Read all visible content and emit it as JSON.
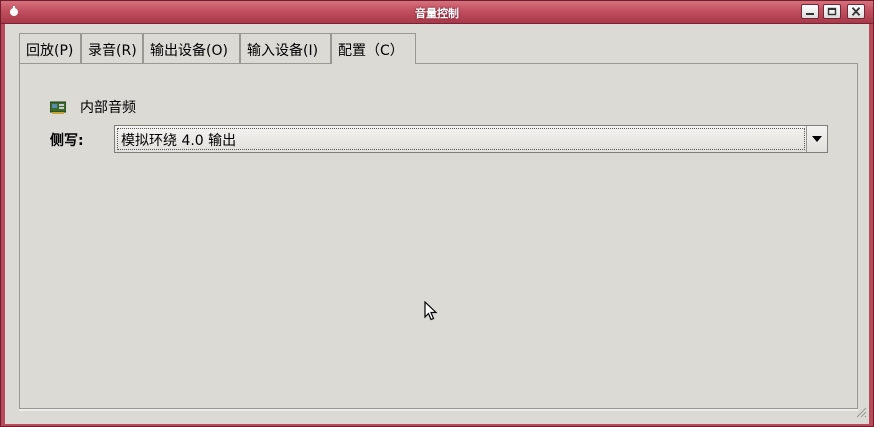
{
  "window": {
    "title": "音量控制",
    "app_icon": "mixer-icon",
    "buttons": [
      "minimize-icon",
      "maximize-icon",
      "close-icon"
    ]
  },
  "tabs": [
    {
      "label": "回放(P)"
    },
    {
      "label": "录音(R)"
    },
    {
      "label": "输出设备(O)"
    },
    {
      "label": "输入设备(I)"
    },
    {
      "label": "配置（C）"
    }
  ],
  "active_tab": "配置（C）",
  "config": {
    "device_icon": "sound-card-icon",
    "device_label": "内部音频",
    "profile_label": "侧写:",
    "profile_value": "模拟环绕 4.0 输出"
  },
  "colors": {
    "titlebar": "#c04f5f",
    "window_bg": "#dcdad5",
    "border": "#9a9893"
  }
}
